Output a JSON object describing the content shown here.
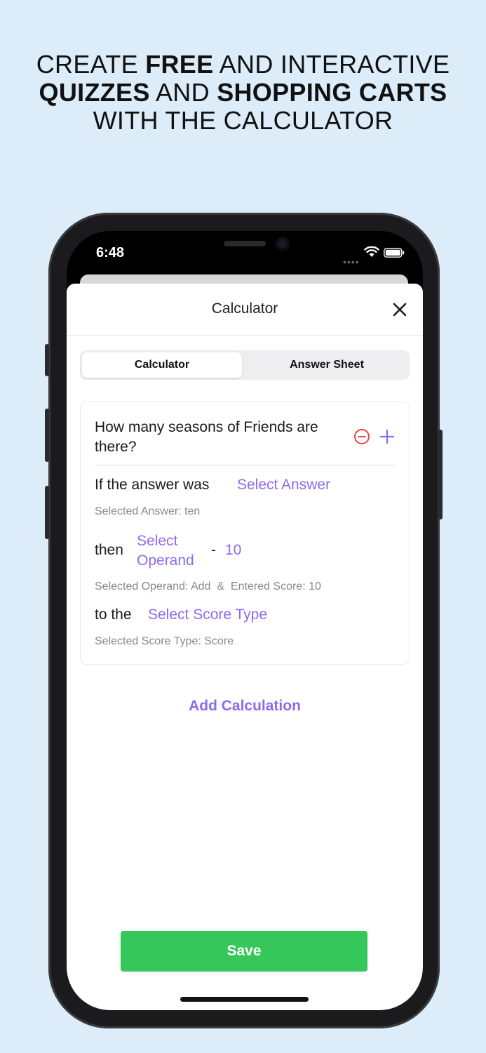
{
  "headline": {
    "line1_pre": "CREATE ",
    "line1_bold": "FREE",
    "line1_post": " AND INTERACTIVE",
    "line2_bold1": "QUIZZES",
    "line2_mid": " AND ",
    "line2_bold2": "SHOPPING CARTS",
    "line3": "WITH THE CALCULATOR"
  },
  "status_bar": {
    "time": "6:48",
    "icons": [
      "signal-icon",
      "wifi-icon",
      "battery-icon"
    ]
  },
  "sheet": {
    "title": "Calculator",
    "close_icon": "close-icon"
  },
  "tabs": [
    {
      "label": "Calculator",
      "selected": true
    },
    {
      "label": "Answer Sheet",
      "selected": false
    }
  ],
  "card": {
    "question": "How many seasons of Friends are there?",
    "remove_icon": "minus-circle-icon",
    "add_icon": "plus-icon",
    "answer_prefix": "If the answer was",
    "answer_link": "Select Answer",
    "answer_selected": "Selected Answer: ten",
    "then_label": "then",
    "operand_link_line1": "Select",
    "operand_link_line2": "Operand",
    "operand_dash": "-",
    "operand_value": "10",
    "operand_selected": "Selected Operand: Add  &  Entered Score: 10",
    "to_label": "to the",
    "score_type_link": "Select Score Type",
    "score_type_selected": "Selected Score Type: Score"
  },
  "add_calculation": "Add Calculation",
  "save": "Save",
  "colors": {
    "background": "#dcedf9",
    "accent_purple": "#8b6cf0",
    "save_green": "#35c75a",
    "remove_red": "#e5484d"
  }
}
